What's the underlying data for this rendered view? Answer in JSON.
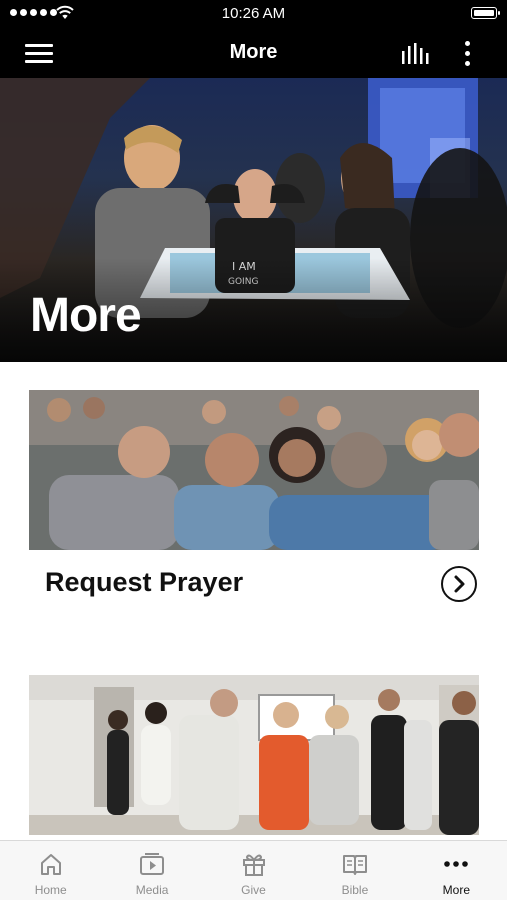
{
  "status_bar": {
    "time": "10:26 AM"
  },
  "nav": {
    "title": "More"
  },
  "hero": {
    "title": "More"
  },
  "cards": [
    {
      "title": "Request Prayer"
    }
  ],
  "tabs": [
    {
      "label": "Home",
      "icon": "home-icon",
      "active": false
    },
    {
      "label": "Media",
      "icon": "media-icon",
      "active": false
    },
    {
      "label": "Give",
      "icon": "gift-icon",
      "active": false
    },
    {
      "label": "Bible",
      "icon": "book-icon",
      "active": false
    },
    {
      "label": "More",
      "icon": "more-dots-icon",
      "active": true
    }
  ],
  "colors": {
    "bar_bg": "#000000",
    "text_dark": "#111111",
    "tab_inactive": "#8e8e8e",
    "tab_active": "#111111"
  }
}
